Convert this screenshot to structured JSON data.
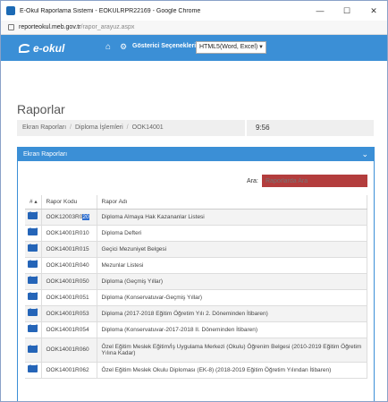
{
  "window": {
    "title": "E-Okul Raporlama Sistemi - EOKULRPR22169 - Google Chrome",
    "minimize": "—",
    "maximize": "☐",
    "close": "✕"
  },
  "address": {
    "host": "reporteokul.meb.gov.tr",
    "path": "/rapor_arayuz.aspx"
  },
  "appbar": {
    "logo": "e-okul",
    "settings_label": "Gösterici Seçenekleri",
    "export_value": "HTML5(Word, Excel)",
    "brand_color": "#3b8fd6"
  },
  "page": {
    "title": "Raporlar",
    "breadcrumb": [
      "Ekran Raporları",
      "Diploma İşlemleri",
      "OOK14001"
    ],
    "time": "9:56"
  },
  "panel": {
    "title": "Ekran Raporları",
    "search_label": "Ara:",
    "search_placeholder": "Raporlarda Ara"
  },
  "table": {
    "headers": [
      "#",
      "Rapor Kodu",
      "Rapor Adı"
    ],
    "rows": [
      {
        "code": "OOK12003R0",
        "code_hl": "20",
        "name": "Diploma Almaya Hak Kazananlar Listesi"
      },
      {
        "code": "OOK14001R010",
        "name": "Diploma Defteri"
      },
      {
        "code": "OOK14001R015",
        "name": "Geçici Mezuniyet Belgesi"
      },
      {
        "code": "OOK14001R040",
        "name": "Mezunlar Listesi"
      },
      {
        "code": "OOK14001R050",
        "name": "Diploma (Geçmiş Yıllar)"
      },
      {
        "code": "OOK14001R051",
        "name": "Diploma (Konservatuvar-Geçmiş Yıllar)"
      },
      {
        "code": "OOK14001R053",
        "name": "Diploma (2017-2018 Eğitim Öğretim Yılı 2. Döneminden İtibaren)"
      },
      {
        "code": "OOK14001R054",
        "name": "Diploma (Konservatuvar-2017-2018 II. Döneminden İtibaren)"
      },
      {
        "code": "OOK14001R060",
        "name": "Özel Eğitim Meslek Eğitim/İş Uygulama Merkezi (Okulu) Öğrenim Belgesi (2010-2019 Eğitim Öğretim Yılına Kadar)"
      },
      {
        "code": "OOK14001R062",
        "name": "Özel Eğitim Meslek Okulu Diploması (EK-8) (2018-2019 Eğitim Öğretim Yılından İtibaren)"
      }
    ]
  }
}
